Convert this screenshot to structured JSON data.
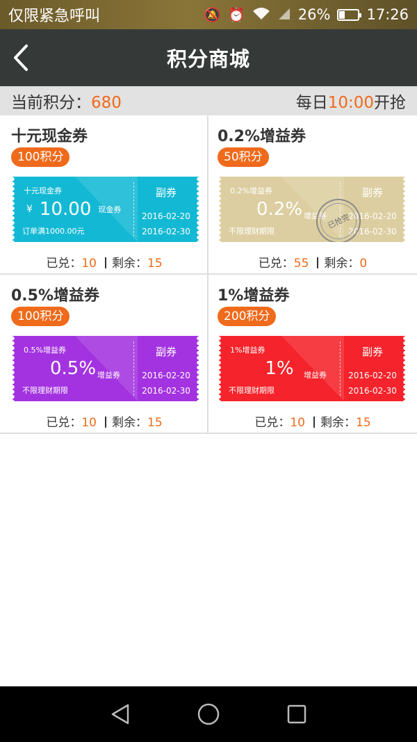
{
  "status_bar": {
    "carrier": "仅限紧急呼叫",
    "battery": "26%",
    "battery_level": 0.26,
    "time": "17:26"
  },
  "header": {
    "title": "积分商城"
  },
  "points_bar": {
    "label": "当前积分：",
    "points": "680",
    "daily_prefix": "每日",
    "daily_time": "10:00",
    "daily_suffix": "开抢"
  },
  "colors": {
    "accent": "#ef6a1a",
    "cyan": "#13b9d4",
    "gold": "#dccea0",
    "purple": "#a333e0",
    "red": "#f5232b"
  },
  "coupons": [
    {
      "title": "十元现金券",
      "cost": "100积分",
      "ticket_name": "十元现金券",
      "yen": "¥",
      "value": "10.00",
      "type": "现金券",
      "condition": "订单满1000.00元",
      "copy": "副券",
      "date_start": "2016-02-20",
      "date_end": "2016-02-30",
      "exchanged_label": "已兑：",
      "exchanged": "10",
      "remaining_label": "剩余：",
      "remaining": "15"
    },
    {
      "title": "0.2%增益券",
      "cost": "50积分",
      "ticket_name": "0.2%增益券",
      "value": "0.2%",
      "type": "增益券",
      "condition": "不限理财期限",
      "copy": "副券",
      "date_start": "2016-02-20",
      "date_end": "2016-02-30",
      "stamp": "已抢完",
      "exchanged_label": "已兑：",
      "exchanged": "55",
      "remaining_label": "剩余：",
      "remaining": "0"
    },
    {
      "title": "0.5%增益券",
      "cost": "100积分",
      "ticket_name": "0.5%增益券",
      "value": "0.5%",
      "type": "增益券",
      "condition": "不限理财期限",
      "copy": "副券",
      "date_start": "2016-02-20",
      "date_end": "2016-02-30",
      "exchanged_label": "已兑：",
      "exchanged": "10",
      "remaining_label": "剩余：",
      "remaining": "15"
    },
    {
      "title": "1%增益券",
      "cost": "200积分",
      "ticket_name": "1%增益券",
      "value": "1%",
      "type": "增益券",
      "condition": "不限理财期限",
      "copy": "副券",
      "date_start": "2016-02-20",
      "date_end": "2016-02-30",
      "exchanged_label": "已兑：",
      "exchanged": "10",
      "remaining_label": "剩余：",
      "remaining": "15"
    }
  ]
}
